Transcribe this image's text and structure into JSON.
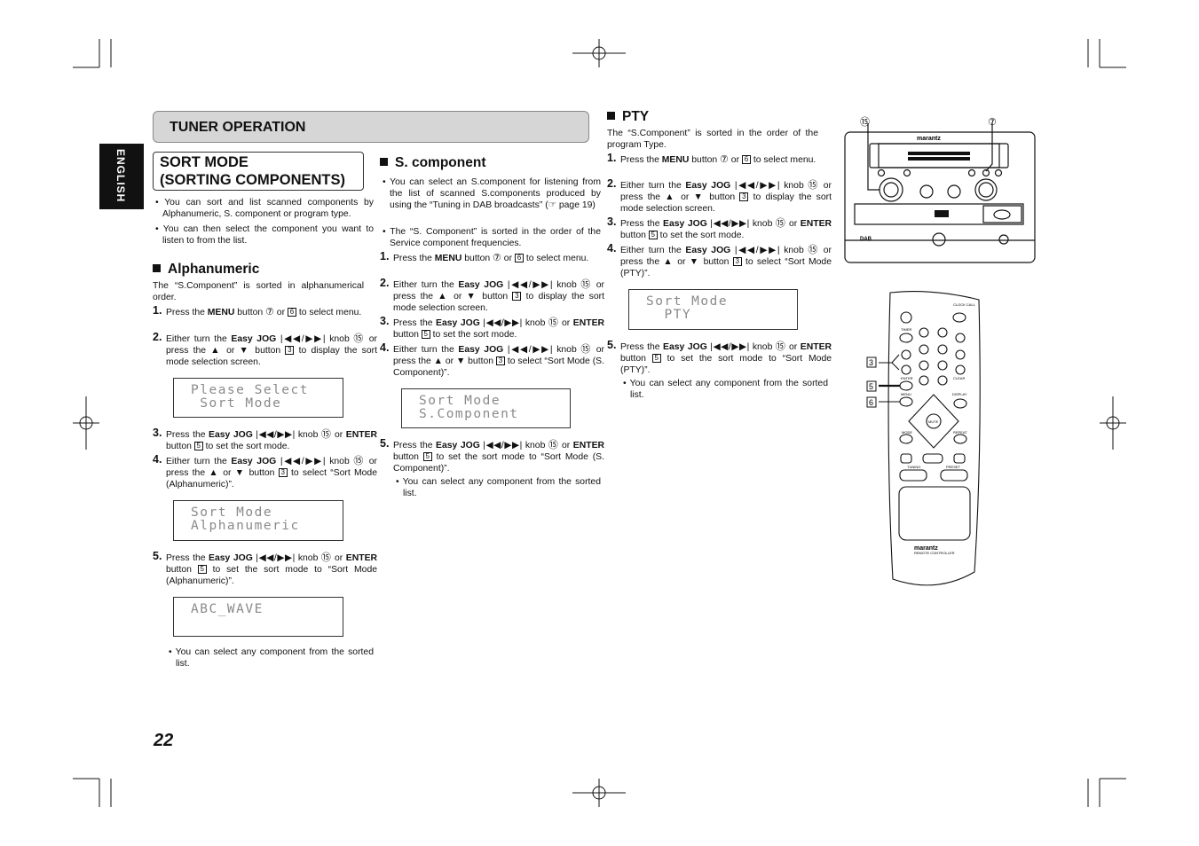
{
  "section_header": "TUNER OPERATION",
  "language_tab": "ENGLISH",
  "page_title_line1": "SORT MODE",
  "page_title_line2": "(SORTING COMPONENTS)",
  "page_number": "22",
  "intro_bullets": [
    "• You can sort and list scanned components by Alphanumeric, S. component or program type.",
    "• You can then select the component you want to listen to from the list."
  ],
  "alphanumeric": {
    "heading": "Alphanumeric",
    "intro": "The “S.Component” is sorted in alphanumerical order.",
    "steps": [
      {
        "n": "1.",
        "segs": [
          {
            "k": "t",
            "v": "Press the "
          },
          {
            "k": "b",
            "v": "MENU"
          },
          {
            "k": "t",
            "v": " button "
          },
          {
            "k": "c",
            "v": "⑦"
          },
          {
            "k": "t",
            "v": " or "
          },
          {
            "k": "k",
            "v": "6"
          },
          {
            "k": "t",
            "v": " to select menu."
          }
        ]
      },
      {
        "n": "2.",
        "segs": [
          {
            "k": "t",
            "v": "Either turn the "
          },
          {
            "k": "b",
            "v": "Easy JOG"
          },
          {
            "k": "t",
            "v": " |◀◀/▶▶| knob "
          },
          {
            "k": "c",
            "v": "⑮"
          },
          {
            "k": "t",
            "v": " or press the ▲ or ▼ button "
          },
          {
            "k": "k",
            "v": "3"
          },
          {
            "k": "t",
            "v": " to display the sort mode selection screen."
          }
        ]
      },
      {
        "n": "3.",
        "segs": [
          {
            "k": "t",
            "v": "Press the "
          },
          {
            "k": "b",
            "v": "Easy JOG"
          },
          {
            "k": "t",
            "v": " |◀◀/▶▶| knob "
          },
          {
            "k": "c",
            "v": "⑮"
          },
          {
            "k": "t",
            "v": " or "
          },
          {
            "k": "b",
            "v": "ENTER"
          },
          {
            "k": "t",
            "v": " button "
          },
          {
            "k": "k",
            "v": "5"
          },
          {
            "k": "t",
            "v": " to set the sort mode."
          }
        ]
      },
      {
        "n": "4.",
        "segs": [
          {
            "k": "t",
            "v": "Either turn the "
          },
          {
            "k": "b",
            "v": "Easy JOG"
          },
          {
            "k": "t",
            "v": " |◀◀/▶▶| knob "
          },
          {
            "k": "c",
            "v": "⑮"
          },
          {
            "k": "t",
            "v": " or press the ▲ or ▼ button "
          },
          {
            "k": "k",
            "v": "3"
          },
          {
            "k": "t",
            "v": " to select “Sort Mode (Alphanumeric)”."
          }
        ]
      },
      {
        "n": "5.",
        "segs": [
          {
            "k": "t",
            "v": "Press the "
          },
          {
            "k": "b",
            "v": "Easy JOG"
          },
          {
            "k": "t",
            "v": " |◀◀/▶▶| knob "
          },
          {
            "k": "c",
            "v": "⑮"
          },
          {
            "k": "t",
            "v": " or "
          },
          {
            "k": "b",
            "v": "ENTER"
          },
          {
            "k": "t",
            "v": " button "
          },
          {
            "k": "k",
            "v": "5"
          },
          {
            "k": "t",
            "v": " to set the sort mode to “Sort Mode (Alphanumeric)”."
          }
        ]
      }
    ],
    "displays": [
      "Please Select\n Sort Mode",
      "Sort Mode\nAlphanumeric",
      "ABC_WAVE"
    ],
    "note": "• You can select any component from the sorted list."
  },
  "scomponent": {
    "heading": "S. component",
    "bullets": [
      "• You can select an S.component for listening from the list of scanned S.components produced by using the “Tuning in DAB broadcasts” (☞ page 19)",
      "• The “S. Component” is sorted in the order of the Service component frequencies."
    ],
    "steps": [
      {
        "n": "1.",
        "segs": [
          {
            "k": "t",
            "v": "Press the "
          },
          {
            "k": "b",
            "v": "MENU"
          },
          {
            "k": "t",
            "v": " button "
          },
          {
            "k": "c",
            "v": "⑦"
          },
          {
            "k": "t",
            "v": " or "
          },
          {
            "k": "k",
            "v": "6"
          },
          {
            "k": "t",
            "v": " to select menu."
          }
        ]
      },
      {
        "n": "2.",
        "segs": [
          {
            "k": "t",
            "v": "Either turn the "
          },
          {
            "k": "b",
            "v": "Easy JOG"
          },
          {
            "k": "t",
            "v": " |◀◀/▶▶| knob "
          },
          {
            "k": "c",
            "v": "⑮"
          },
          {
            "k": "t",
            "v": " or press the ▲ or ▼ button "
          },
          {
            "k": "k",
            "v": "3"
          },
          {
            "k": "t",
            "v": " to display the sort mode selection screen."
          }
        ]
      },
      {
        "n": "3.",
        "segs": [
          {
            "k": "t",
            "v": "Press the "
          },
          {
            "k": "b",
            "v": "Easy JOG"
          },
          {
            "k": "t",
            "v": " |◀◀/▶▶| knob "
          },
          {
            "k": "c",
            "v": "⑮"
          },
          {
            "k": "t",
            "v": " or "
          },
          {
            "k": "b",
            "v": "ENTER"
          },
          {
            "k": "t",
            "v": " button "
          },
          {
            "k": "k",
            "v": "5"
          },
          {
            "k": "t",
            "v": " to set the sort mode."
          }
        ]
      },
      {
        "n": "4.",
        "segs": [
          {
            "k": "t",
            "v": "Either turn the "
          },
          {
            "k": "b",
            "v": "Easy JOG"
          },
          {
            "k": "t",
            "v": " |◀◀/▶▶| knob "
          },
          {
            "k": "c",
            "v": "⑮"
          },
          {
            "k": "t",
            "v": " or press the ▲ or ▼ button "
          },
          {
            "k": "k",
            "v": "3"
          },
          {
            "k": "t",
            "v": " to select “Sort Mode (S. Component)”."
          }
        ]
      },
      {
        "n": "5.",
        "segs": [
          {
            "k": "t",
            "v": "Press the "
          },
          {
            "k": "b",
            "v": "Easy JOG"
          },
          {
            "k": "t",
            "v": " |◀◀/▶▶| knob "
          },
          {
            "k": "c",
            "v": "⑮"
          },
          {
            "k": "t",
            "v": " or "
          },
          {
            "k": "b",
            "v": "ENTER"
          },
          {
            "k": "t",
            "v": " button "
          },
          {
            "k": "k",
            "v": "5"
          },
          {
            "k": "t",
            "v": " to set the sort mode to “Sort Mode (S. Component)”."
          }
        ]
      }
    ],
    "display": "Sort Mode\nS.Component",
    "note": "• You can select any component from the sorted list."
  },
  "pty": {
    "heading": "PTY",
    "intro": "The “S.Component” is sorted in the order of the program Type.",
    "steps": [
      {
        "n": "1.",
        "segs": [
          {
            "k": "t",
            "v": "Press the "
          },
          {
            "k": "b",
            "v": "MENU"
          },
          {
            "k": "t",
            "v": " button "
          },
          {
            "k": "c",
            "v": "⑦"
          },
          {
            "k": "t",
            "v": " or "
          },
          {
            "k": "k",
            "v": "6"
          },
          {
            "k": "t",
            "v": " to select menu."
          }
        ]
      },
      {
        "n": "2.",
        "segs": [
          {
            "k": "t",
            "v": "Either turn the "
          },
          {
            "k": "b",
            "v": "Easy JOG"
          },
          {
            "k": "t",
            "v": " |◀◀/▶▶| knob "
          },
          {
            "k": "c",
            "v": "⑮"
          },
          {
            "k": "t",
            "v": " or press the ▲ or ▼ button "
          },
          {
            "k": "k",
            "v": "3"
          },
          {
            "k": "t",
            "v": " to display the sort mode selection screen."
          }
        ]
      },
      {
        "n": "3.",
        "segs": [
          {
            "k": "t",
            "v": "Press the "
          },
          {
            "k": "b",
            "v": "Easy JOG"
          },
          {
            "k": "t",
            "v": " |◀◀/▶▶| knob "
          },
          {
            "k": "c",
            "v": "⑮"
          },
          {
            "k": "t",
            "v": " or "
          },
          {
            "k": "b",
            "v": "ENTER"
          },
          {
            "k": "t",
            "v": " button "
          },
          {
            "k": "k",
            "v": "5"
          },
          {
            "k": "t",
            "v": " to set the sort mode."
          }
        ]
      },
      {
        "n": "4.",
        "segs": [
          {
            "k": "t",
            "v": "Either turn the "
          },
          {
            "k": "b",
            "v": "Easy JOG"
          },
          {
            "k": "t",
            "v": " |◀◀/▶▶| knob "
          },
          {
            "k": "c",
            "v": "⑮"
          },
          {
            "k": "t",
            "v": " or press the ▲ or ▼ button "
          },
          {
            "k": "k",
            "v": "3"
          },
          {
            "k": "t",
            "v": " to select “Sort Mode (PTY)”."
          }
        ]
      },
      {
        "n": "5.",
        "segs": [
          {
            "k": "t",
            "v": "Press the "
          },
          {
            "k": "b",
            "v": "Easy JOG"
          },
          {
            "k": "t",
            "v": " |◀◀/▶▶| knob "
          },
          {
            "k": "c",
            "v": "⑮"
          },
          {
            "k": "t",
            "v": " or "
          },
          {
            "k": "b",
            "v": "ENTER"
          },
          {
            "k": "t",
            "v": " button "
          },
          {
            "k": "k",
            "v": "5"
          },
          {
            "k": "t",
            "v": " to set the sort mode to “Sort Mode (PTY)”."
          }
        ]
      }
    ],
    "display": "Sort Mode\n  PTY",
    "note": "• You can select any component from the sorted list."
  },
  "figures": {
    "main_unit_callouts": [
      "⑮",
      "⑦"
    ],
    "brand": "marantz",
    "remote_callouts": [
      "3",
      "5",
      "6"
    ],
    "remote_label": "REMOTE CONTROLLER",
    "remote_keys": [
      "CLOCK CALL",
      "TIMER",
      "ENTER",
      "CLEAR",
      "MENU",
      "DISPLAY",
      "MUTE",
      "MODE",
      "REPEAT",
      "TUNING",
      "PRESET"
    ]
  }
}
